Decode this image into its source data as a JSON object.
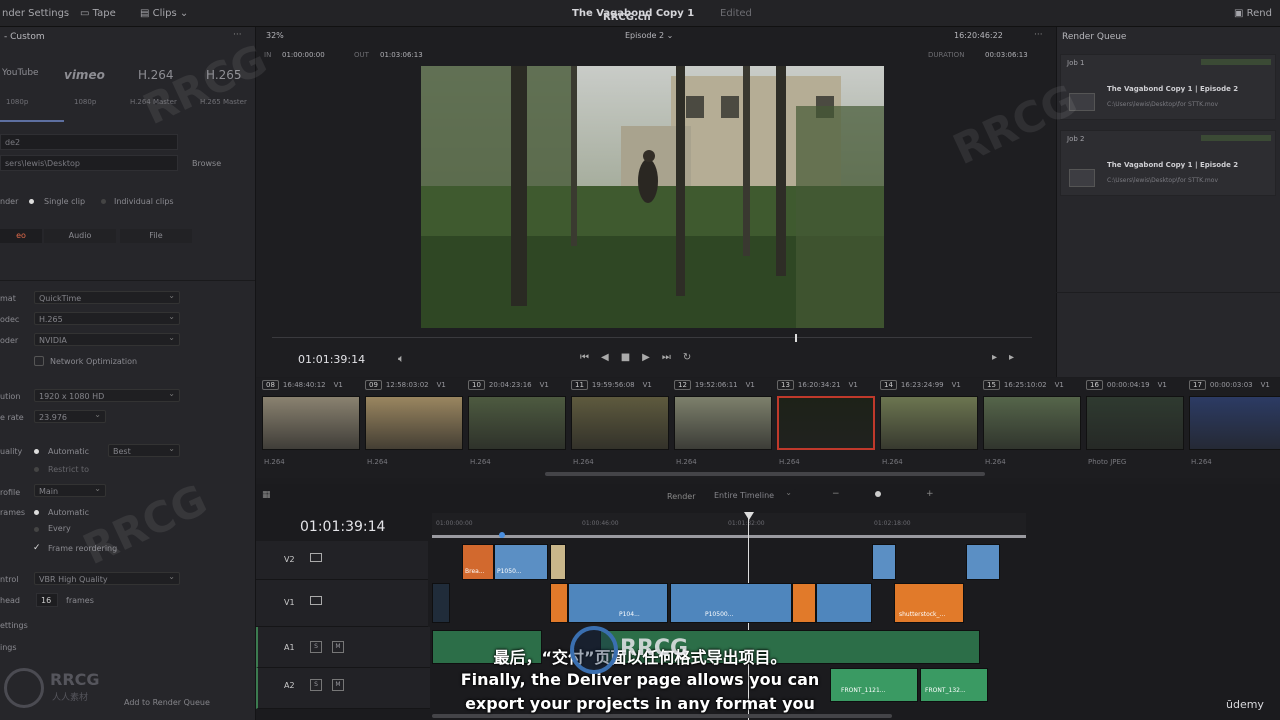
{
  "topbar": {
    "render_settings": "nder Settings",
    "tape": "Tape",
    "clips": "Clips",
    "project_title": "The Vagabond Copy 1",
    "edited": "Edited",
    "watermark_top": "RRCG.cn",
    "render_label": "Rend"
  },
  "left_panel": {
    "custom_title": "- Custom",
    "codecs": [
      {
        "name": "YouTube",
        "sub": "1080p"
      },
      {
        "name": "vimeo",
        "sub": "1080p"
      },
      {
        "name": "H.264",
        "sub": "H.264 Master"
      },
      {
        "name": "H.265",
        "sub": "H.265 Master"
      }
    ],
    "filename_value": "de2",
    "location_value": "sers\\lewis\\Desktop",
    "browse_label": "Browse",
    "render_label": "nder",
    "single_clip": "Single clip",
    "individual_clips": "Individual clips",
    "tabs": [
      "eo",
      "Audio",
      "File"
    ],
    "format_label": "mat",
    "format_value": "QuickTime",
    "codec_label": "odec",
    "codec_value": "H.265",
    "encoder_label": "oder",
    "encoder_value": "NVIDIA",
    "network_opt": "Network Optimization",
    "resolution_label": "ution",
    "resolution_value": "1920 x 1080 HD",
    "framerate_label": "e rate",
    "framerate_value": "23.976",
    "quality_label": "uality",
    "quality_auto": "Automatic",
    "quality_value": "Best",
    "restrict_label": "Restrict to",
    "profile_label": "rofile",
    "profile_value": "Main",
    "keyframes_label": "rames",
    "keyframes_auto": "Automatic",
    "every_label": "Every",
    "frame_reordering": "Frame reordering",
    "control_label": "ntrol",
    "control_value": "VBR High Quality",
    "lookahead_label": "head",
    "lookahead_value": "16",
    "frames_label": "frames",
    "settings_label": "ettings",
    "ings_label": "ings",
    "add_queue": "Add to Render Queue"
  },
  "viewer": {
    "zoom": "32%",
    "timeline_name": "Episode 2",
    "timecode_top": "16:20:46:22",
    "in_label": "IN",
    "in_value": "01:00:00:00",
    "out_label": "OUT",
    "out_value": "01:03:06:13",
    "duration_label": "DURATION",
    "duration_value": "00:03:06:13",
    "current_tc": "01:01:39:14"
  },
  "render_queue": {
    "title": "Render Queue",
    "jobs": [
      {
        "id": "Job 1",
        "name": "The Vagabond Copy 1 | Episode 2",
        "path": "C:\\Users\\lewis\\Desktop\\for STTK.mov"
      },
      {
        "id": "Job 2",
        "name": "The Vagabond Copy 1 | Episode 2",
        "path": "C:\\Users\\lewis\\Desktop\\for STTK.mov"
      }
    ]
  },
  "clips": [
    {
      "num": "08",
      "tc": "16:48:40:12",
      "track": "V1",
      "codec": "H.264"
    },
    {
      "num": "09",
      "tc": "12:58:03:02",
      "track": "V1",
      "codec": "H.264"
    },
    {
      "num": "10",
      "tc": "20:04:23:16",
      "track": "V1",
      "codec": "H.264"
    },
    {
      "num": "11",
      "tc": "19:59:56:08",
      "track": "V1",
      "codec": "H.264"
    },
    {
      "num": "12",
      "tc": "19:52:06:11",
      "track": "V1",
      "codec": "H.264"
    },
    {
      "num": "13",
      "tc": "16:20:34:21",
      "track": "V1",
      "codec": "H.264"
    },
    {
      "num": "14",
      "tc": "16:23:24:99",
      "track": "V1",
      "codec": "H.264"
    },
    {
      "num": "15",
      "tc": "16:25:10:02",
      "track": "V1",
      "codec": "H.264"
    },
    {
      "num": "16",
      "tc": "00:00:04:19",
      "track": "V1",
      "codec": "Photo JPEG"
    },
    {
      "num": "17",
      "tc": "00:00:03:03",
      "track": "V1",
      "codec": "H.264"
    }
  ],
  "timeline": {
    "render_label": "Render",
    "render_value": "Entire Timeline",
    "current_tc": "01:01:39:14",
    "ruler": [
      "01:00:00:00",
      "01:00:46:00",
      "01:01:32:00",
      "01:02:18:00"
    ],
    "tracks": [
      "V2",
      "V1",
      "A1",
      "A2"
    ],
    "clip_labels": [
      "Brea...",
      "P1050...",
      "P104...",
      "P10500...",
      "shutterstock_...",
      "FRONT_1121...",
      "FRONT_132..."
    ]
  },
  "subtitles": {
    "line1": "最后，“交付”页面以任何格式导出项目。",
    "line2": "Finally, the Deliver page allows you can",
    "line3": "export your projects in any format you"
  },
  "branding": {
    "rrcg": "RRCG",
    "rrcg_sub": "人人素材",
    "udemy": "ūdemy"
  }
}
